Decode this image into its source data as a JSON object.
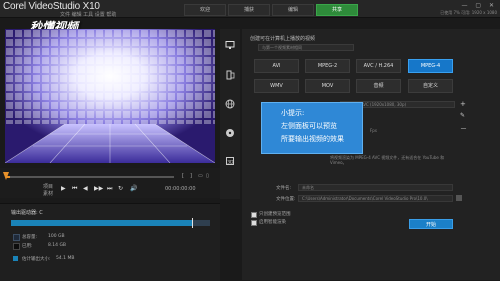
{
  "app": {
    "title": "Corel VideoStudio X10",
    "menu": "文件  编辑  工具  设置  帮助",
    "watermark": "秒懂视频",
    "window_controls": "— ▢ ✕",
    "sysinfo": "已使用 7% 可用: 1920 x 1080"
  },
  "tabs": [
    {
      "label": "欢迎",
      "active": false
    },
    {
      "label": "捕获",
      "active": false
    },
    {
      "label": "编辑",
      "active": false
    },
    {
      "label": "共享",
      "active": true
    }
  ],
  "player": {
    "mode_label": "项目",
    "clip_label": "素材",
    "buttons": [
      "⏮",
      "◀",
      "▶",
      "▶▶",
      "⏭",
      "↻",
      "🔊"
    ],
    "marks": [
      "[",
      "]",
      "▭",
      "▯"
    ],
    "timecode": "00:00:00:00"
  },
  "disk": {
    "title": "输出驱动器: C",
    "items": [
      {
        "label": "总容量:",
        "value": "100 GB",
        "color": "#1f2a3a"
      },
      {
        "label": "已用:",
        "value": "8.14 GB",
        "color": "#0d0d0d"
      },
      {
        "label": "估计输出大小:",
        "value": "54.1 MB",
        "color": "#1a83b8"
      }
    ],
    "used_fraction": 0.91
  },
  "sidebar_icons": [
    "monitor-icon",
    "device-icon",
    "globe-icon",
    "disc-icon",
    "3d-icon"
  ],
  "output": {
    "heading": "创建可在计算机上播放的视频",
    "profile_dropdown": "与第一个视频素材相同",
    "formats": [
      {
        "label": "AVI",
        "selected": false
      },
      {
        "label": "MPEG-2",
        "selected": false
      },
      {
        "label": "AVC / H.264",
        "selected": false
      },
      {
        "label": "MPEG-4",
        "selected": true
      },
      {
        "label": "WMV",
        "selected": false
      },
      {
        "label": "MOV",
        "selected": false
      },
      {
        "label": "音频",
        "selected": false
      },
      {
        "label": "自定义",
        "selected": false
      }
    ],
    "profile_select": "MPEG-4 AVC (1920x1080, 30p)",
    "profile_detail": "Fps",
    "description": "将视频渲染为 MPEG-4 AVC 视频文件，还有适合在 YouTube 和 Vimeo。",
    "file_name_label": "文件名:",
    "file_name_value": "未命名",
    "file_location_label": "文件位置:",
    "file_location_value": "C:\\Users\\Administrator\\Documents\\Corel VideoStudio Pro\\10.0\\",
    "option1": "只创建预览范围",
    "option2": "启用智能渲染",
    "start": "开始",
    "side_buttons": [
      "+",
      "✎",
      "－"
    ]
  },
  "tooltip": {
    "title": "小提示:",
    "line1": "左侧面板可以预览",
    "line2": "所要输出视频的效果"
  }
}
